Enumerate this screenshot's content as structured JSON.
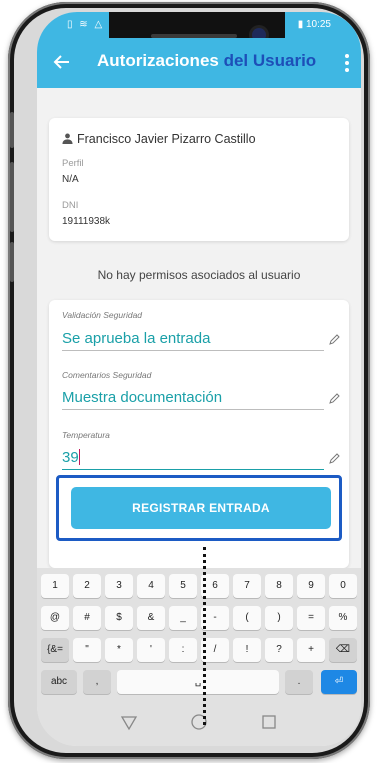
{
  "status_bar": {
    "left_icons": "▯ ≋ △ ▪",
    "time": "10:25"
  },
  "app_bar": {
    "title_part1": "Autorizaciones",
    "title_part2": "del Usuario"
  },
  "user": {
    "name": "Francisco Javier Pizarro Castillo",
    "perfil_label": "Perfil",
    "perfil_value": "N/A",
    "dni_label": "DNI",
    "dni_value": "19111938k"
  },
  "no_permissions": "No hay permisos asociados al usuario",
  "form": {
    "validacion_label": "Validación Seguridad",
    "validacion_value": "Se aprueba la entrada",
    "comentarios_label": "Comentarios Seguridad",
    "comentarios_value": "Muestra documentación",
    "temperatura_label": "Temperatura",
    "temperatura_value": "39",
    "submit_label": "REGISTRAR ENTRADA"
  },
  "keyboard": {
    "row1": [
      "1",
      "2",
      "3",
      "4",
      "5",
      "6",
      "7",
      "8",
      "9",
      "0"
    ],
    "row2": [
      "@",
      "#",
      "$",
      "&",
      "_",
      "-",
      "(",
      ")",
      "=",
      "%"
    ],
    "row3": [
      "{&=",
      "\"",
      "*",
      "'",
      ":",
      "/",
      "!",
      "?",
      "+",
      "⌫"
    ],
    "row4": [
      "abc",
      ",",
      "␣",
      ".",
      "⏎"
    ]
  },
  "colors": {
    "accent": "#3fb7e3",
    "title_blue": "#1d4fb8",
    "field_text": "#1aa0a8",
    "highlight": "#1c5bc4"
  }
}
